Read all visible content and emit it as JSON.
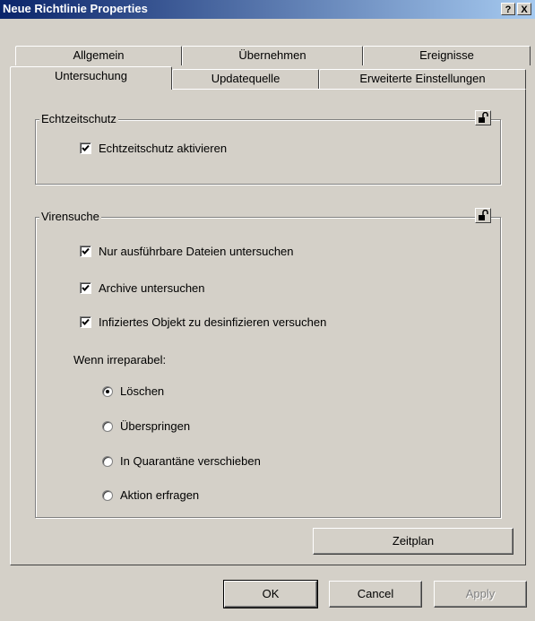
{
  "window": {
    "title": "Neue Richtlinie Properties",
    "help_label": "?",
    "close_label": "X"
  },
  "tabs_row1": [
    "Allgemein",
    "Übernehmen",
    "Ereignisse"
  ],
  "tabs_row2": [
    "Untersuchung",
    "Updatequelle",
    "Erweiterte Einstellungen"
  ],
  "active_tab": "Untersuchung",
  "echtzeitschutz": {
    "legend": "Echtzeitschutz",
    "checkbox_label": "Echtzeitschutz aktivieren",
    "checked": true
  },
  "virensuche": {
    "legend": "Virensuche",
    "options": [
      {
        "label": "Nur ausführbare Dateien untersuchen",
        "checked": true
      },
      {
        "label": "Archive untersuchen",
        "checked": true
      },
      {
        "label": "Infiziertes Objekt zu desinfizieren versuchen",
        "checked": true
      }
    ],
    "irreparable_label": "Wenn irreparabel:",
    "radios": [
      {
        "label": "Löschen",
        "selected": true
      },
      {
        "label": "Überspringen",
        "selected": false
      },
      {
        "label": "In Quarantäne verschieben",
        "selected": false
      },
      {
        "label": "Aktion erfragen",
        "selected": false
      }
    ]
  },
  "buttons": {
    "schedule": "Zeitplan",
    "ok": "OK",
    "cancel": "Cancel",
    "apply": "Apply"
  }
}
